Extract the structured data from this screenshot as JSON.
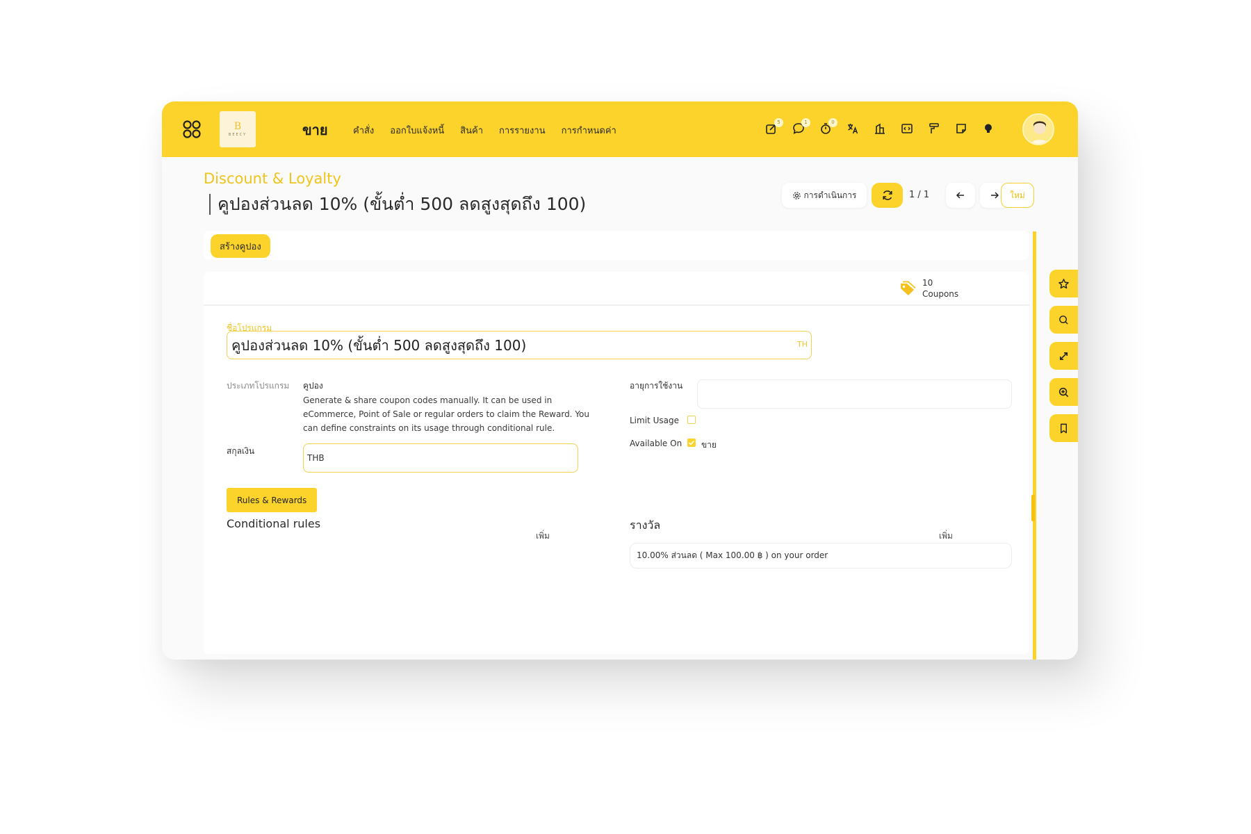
{
  "navbar": {
    "module": "ขาย",
    "menu": [
      "คำสั่ง",
      "ออกใบแจ้งหนี้",
      "สินค้า",
      "การรายงาน",
      "การกำหนดค่า"
    ],
    "logo_mark": "B",
    "logo_text": "BEECY",
    "badges": {
      "activity": "5",
      "messages": "1",
      "timer": "0"
    }
  },
  "control": {
    "breadcrumb": "Discount & Loyalty",
    "title": "คูปองส่วนลด 10% (ขั้นต่ำ 500 ลดสูงสุดถึง 100)",
    "action_label": "การดำเนินการ",
    "pager": "1 / 1",
    "new_label": "ใหม่"
  },
  "statusbar": {
    "generate_label": "สร้างคูปอง"
  },
  "smart_button": {
    "count": "10",
    "label": "Coupons"
  },
  "form": {
    "name_label": "ชื่อโปรแกรม",
    "name_value": "คูปองส่วนลด 10% (ขั้นต่ำ 500 ลดสูงสุดถึง 100)",
    "lang": "TH",
    "program_type_label": "ประเภทโปรแกรม",
    "program_type_value": "คูปอง",
    "program_type_desc": "Generate & share coupon codes manually. It can be used in eCommerce, Point of Sale or regular orders to claim the Reward. You can define constraints on its usage through conditional rule.",
    "currency_label": "สกุลเงิน",
    "currency_value": "THB",
    "validity_label": "อายุการใช้งาน",
    "validity_value": "",
    "limit_usage_label": "Limit Usage",
    "limit_usage_checked": false,
    "available_on_label": "Available On",
    "available_on_option": "ขาย",
    "available_on_checked": true
  },
  "tabs": {
    "active": "Rules & Rewards"
  },
  "rules": {
    "title": "Conditional rules",
    "add_label": "เพิ่ม"
  },
  "rewards": {
    "title": "รางวัล",
    "add_label": "เพิ่ม",
    "items": [
      "10.00% ส่วนลด ( Max 100.00 ฿ ) on your order"
    ]
  },
  "side_tools": [
    "star-icon",
    "search-icon",
    "expand-icon",
    "zoom-in-icon",
    "bookmark-icon"
  ],
  "colors": {
    "accent": "#fcd32b",
    "accent_text": "#f1c41c"
  }
}
